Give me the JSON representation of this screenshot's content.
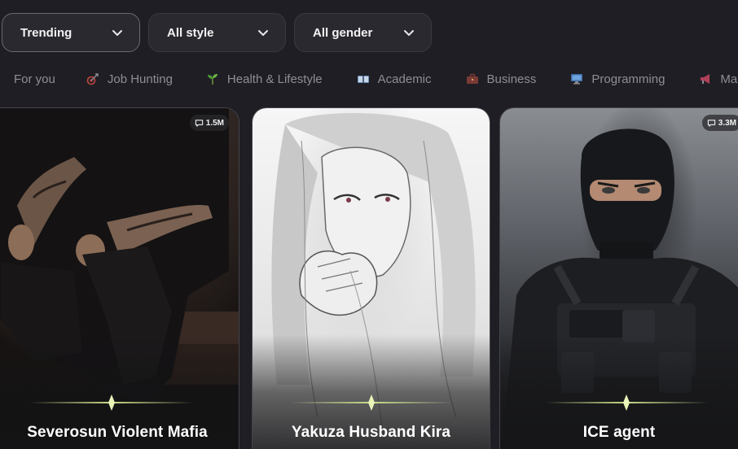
{
  "filters": {
    "sort": "Trending",
    "style": "All style",
    "gender": "All gender"
  },
  "tabs": [
    {
      "label": "For you",
      "icon": "none"
    },
    {
      "label": "Job Hunting",
      "icon": "target-arrow-icon"
    },
    {
      "label": "Health & Lifestyle",
      "icon": "sprout-icon"
    },
    {
      "label": "Academic",
      "icon": "book-icon"
    },
    {
      "label": "Business",
      "icon": "briefcase-icon"
    },
    {
      "label": "Programming",
      "icon": "computer-icon"
    },
    {
      "label": "Ma",
      "icon": "megaphone-icon"
    }
  ],
  "cards": [
    {
      "title": "Severosun Violent Mafia",
      "count": "1.5M",
      "image": "tattooed-man-in-black-suit"
    },
    {
      "title": "Yakuza Husband Kira",
      "count": "",
      "image": "sketch-long-haired-man"
    },
    {
      "title": "ICE agent",
      "count": "3.3M",
      "image": "masked-tactical-agent"
    }
  ],
  "colors": {
    "background": "#1f1e24",
    "dropdown_bg": "#2a292f",
    "tab_text": "#8f8e95",
    "divider_glow": "#c9e08a"
  }
}
